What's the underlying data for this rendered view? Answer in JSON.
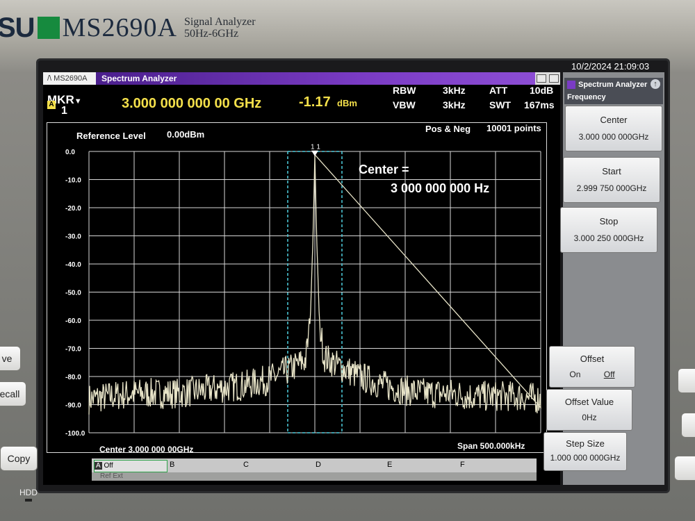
{
  "brand": {
    "partial": "SU",
    "model": "MS2690A",
    "description_line1": "Signal Analyzer",
    "description_line2": "50Hz-6GHz"
  },
  "datetime": "10/2/2024 21:09:03",
  "window": {
    "logo": "/\\ MS2690A",
    "title": "Spectrum Analyzer"
  },
  "marker": {
    "label": "MKR",
    "number": "1",
    "badge": "A",
    "frequency": "3.000 000 000 00 GHz",
    "level": "-1.17",
    "level_unit": "dBm"
  },
  "settings": {
    "rbw_label": "RBW",
    "rbw": "3kHz",
    "vbw_label": "VBW",
    "vbw": "3kHz",
    "att_label": "ATT",
    "att": "10dB",
    "swt_label": "SWT",
    "swt": "167ms"
  },
  "plot": {
    "ref_label": "Reference Level",
    "ref_value": "0.00dBm",
    "detector": "Pos & Neg",
    "points": "10001 points",
    "marker_tag": "1 1",
    "annotation_line1": "Center =",
    "annotation_line2": "3 000 000 000 Hz",
    "center_label": "Center 3.000 000 00GHz",
    "span_label": "Span 500.000kHz"
  },
  "chart_data": {
    "type": "line",
    "xlim": [
      2999750000,
      3000250000
    ],
    "ylim": [
      -100,
      0
    ],
    "y_ticks": [
      "0.0",
      "-10.0",
      "-20.0",
      "-30.0",
      "-40.0",
      "-50.0",
      "-60.0",
      "-70.0",
      "-80.0",
      "-90.0",
      "-100.0"
    ],
    "grid": true,
    "series": [
      {
        "x": [
          2999750000,
          2999775000,
          2999800000,
          2999825000,
          2999850000,
          2999875000,
          2999900000,
          2999925000,
          2999950000,
          2999975000,
          2999990000,
          2999995000,
          2999998000,
          3000000000,
          3000002000,
          3000005000,
          3000010000,
          3000025000,
          3000050000,
          3000075000,
          3000100000,
          3000125000,
          3000150000,
          3000175000,
          3000200000,
          3000225000,
          3000250000
        ],
        "y": [
          -88,
          -87,
          -86,
          -86,
          -86,
          -85,
          -84,
          -83,
          -81,
          -77,
          -74,
          -60,
          -30,
          -1.17,
          -30,
          -60,
          -73,
          -76,
          -80,
          -83,
          -85,
          -86,
          -86,
          -87,
          -87,
          -87,
          -88
        ]
      }
    ],
    "marker": {
      "x": 3000000000,
      "y": -1.17
    },
    "vertical_lines": [
      2999970000,
      3000030000
    ]
  },
  "softkeys_tabs": [
    "A",
    "Off",
    "B",
    "C",
    "D",
    "E",
    "F"
  ],
  "status": "Ref Ext",
  "side_panel": {
    "mode": "Spectrum Analyzer",
    "function": "Frequency",
    "keys": [
      {
        "label": "Center",
        "value": "3.000 000 000GHz"
      },
      {
        "label": "Start",
        "value": "2.999 750 000GHz"
      },
      {
        "label": "Stop",
        "value": "3.000 250 000GHz"
      },
      {
        "label": "Offset",
        "value_on": "On",
        "value_off": "Off"
      },
      {
        "label": "Offset Value",
        "value": "0Hz"
      },
      {
        "label": "Step Size",
        "value": "1.000 000 000GHz"
      }
    ]
  },
  "hardware": {
    "save": "ve",
    "recall": "ecall",
    "copy": "Copy",
    "hdd": "HDD"
  }
}
